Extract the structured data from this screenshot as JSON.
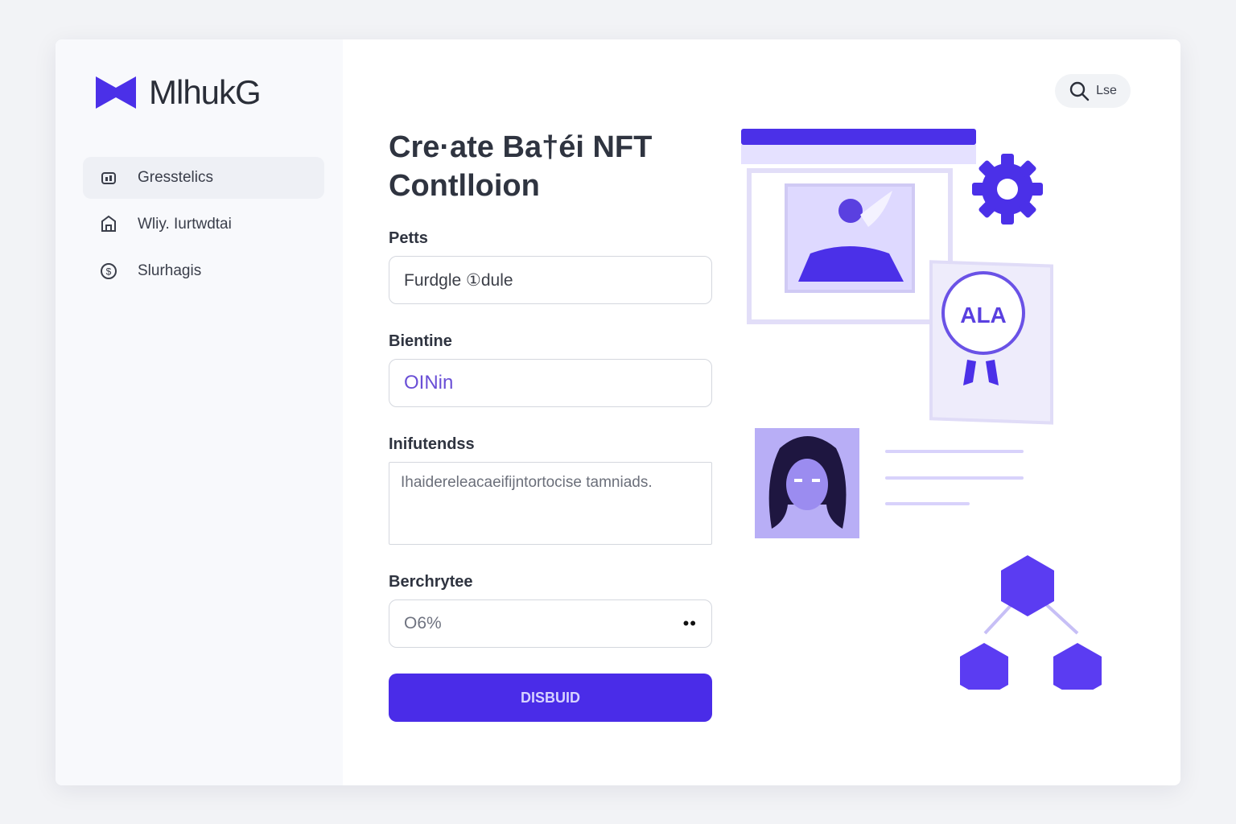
{
  "brand": {
    "name": "MlhukG",
    "logo_icon": "bowtie-logo-icon",
    "color": "#4b30e8"
  },
  "search": {
    "label": "Lse",
    "icon": "search-icon"
  },
  "sidebar": {
    "items": [
      {
        "label": "Gresstelics",
        "icon": "chart-icon",
        "active": true
      },
      {
        "label": "Wliy. Iurtwdtai",
        "icon": "shield-icon",
        "active": false
      },
      {
        "label": "Slurhagis",
        "icon": "dollar-icon",
        "active": false
      }
    ]
  },
  "form": {
    "title_line1": "Cre·ate Ba†éi NFT",
    "title_line2": "Contlloion",
    "field1": {
      "label": "Petts",
      "value": "Furdgle ①dule"
    },
    "field2": {
      "label": "Bientine",
      "value": "OINin"
    },
    "field3": {
      "label": "Inifutendss",
      "value": "Ihaidereleacaeifijntortocise tamniads."
    },
    "field4": {
      "label": "Berchrytee",
      "value": "O6%",
      "menu_glyph": "••"
    },
    "submit_label": "DISBUID"
  },
  "illustration": {
    "badge_text": "ALA",
    "accent": "#4b30e8",
    "light": "#d9d4ff"
  }
}
